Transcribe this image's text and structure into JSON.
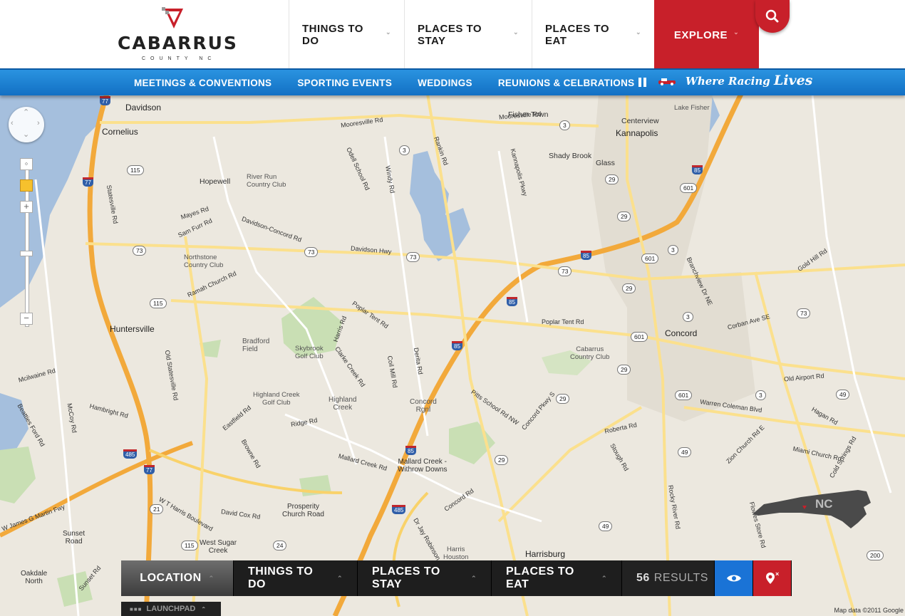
{
  "brand": {
    "name": "CABARRUS",
    "sub": "COUNTY NC"
  },
  "main_nav": [
    {
      "label": "THINGS TO DO"
    },
    {
      "label": "PLACES TO STAY"
    },
    {
      "label": "PLACES TO EAT"
    },
    {
      "label": "EXPLORE"
    }
  ],
  "sub_nav": [
    {
      "label": "MEETINGS & CONVENTIONS"
    },
    {
      "label": "SPORTING EVENTS"
    },
    {
      "label": "WEDDINGS"
    },
    {
      "label": "REUNIONS & CELBRATIONS"
    }
  ],
  "tagline": {
    "line1": "Where Racing",
    "line2": "Lives"
  },
  "map": {
    "cities": [
      {
        "name": "Davidson"
      },
      {
        "name": "Cornelius"
      },
      {
        "name": "Kannapolis"
      },
      {
        "name": "Concord"
      },
      {
        "name": "Huntersville"
      },
      {
        "name": "Harrisburg"
      },
      {
        "name": "Hopewell"
      },
      {
        "name": "Centerview"
      },
      {
        "name": "Fisher Town"
      },
      {
        "name": "Shady Brook"
      },
      {
        "name": "Glass"
      }
    ],
    "places": [
      {
        "name": "River Run\nCountry Club"
      },
      {
        "name": "Northstone\nCountry Club"
      },
      {
        "name": "Bradford\nField"
      },
      {
        "name": "Skybrook\nGolf Club"
      },
      {
        "name": "Highland Creek\nGolf Club"
      },
      {
        "name": "Highland\nCreek"
      },
      {
        "name": "Concord\nRgnl"
      },
      {
        "name": "Cabarrus\nCountry Club"
      },
      {
        "name": "Mallard Creek -\nWithrow Downs"
      },
      {
        "name": "Prosperity\nChurch Road"
      },
      {
        "name": "West Sugar\nCreek"
      },
      {
        "name": "Harris\nHouston"
      },
      {
        "name": "Sunset\nRoad"
      },
      {
        "name": "Oakdale\nNorth"
      },
      {
        "name": "Lake Fisher"
      }
    ],
    "roads": [
      "Mooresville Rd",
      "Davidson Hwy",
      "Davidson-Concord Rd",
      "Poplar Tent Rd",
      "Sam Furr Rd",
      "Mayes Rd",
      "Ramah Church Rd",
      "Statesville Rd",
      "Old Statesville Rd",
      "Hambright Rd",
      "Beatties Ford Rd",
      "Mallard Creek Rd",
      "Pitts School Rd NW",
      "Concord Pkwy S",
      "Roberta Rd",
      "Warren Coleman Blvd",
      "Old Airport Rd",
      "Miami Church Rd",
      "Zion Church Rd E",
      "Poplar Tent Rd",
      "David Cox Rd",
      "W T Harris Boulevard",
      "W James G Martin Fwy",
      "Concord Rd",
      "Odell School Rd",
      "Windy Rd",
      "Rankin Rd",
      "Kannapolis Pkwy",
      "Derita Rd",
      "Dr Jay Robinson",
      "Gold Hill Rd",
      "Corban Ave SE",
      "Branchview Dr NE",
      "Cold Springs Rd",
      "Hagan Rd",
      "Flowes Store Rd",
      "Rocky River Rd",
      "Stough Rd",
      "Mooresville Rd",
      "Ridge Rd",
      "Eastfield Rd",
      "Browne Rd",
      "Clarke Creek Rd",
      "Harris Rd",
      "Coil Mill Rd",
      "Sunset Rd",
      "McCoy Rd",
      "Mcilwaine Rd"
    ],
    "shields_state": [
      "3",
      "3",
      "73",
      "73",
      "73",
      "73",
      "115",
      "115",
      "115",
      "29",
      "29",
      "29",
      "29",
      "29",
      "29",
      "601",
      "601",
      "601",
      "601",
      "3",
      "3",
      "49",
      "49",
      "49",
      "200",
      "24",
      "21",
      "3",
      "73"
    ],
    "shields_interstate": [
      "77",
      "77",
      "85",
      "85",
      "85",
      "85",
      "85",
      "485",
      "485",
      "77"
    ],
    "copyright": "Map data ©2011 Google"
  },
  "bottom_bar": {
    "location": "LOCATION",
    "things": "THINGS TO DO",
    "stay": "PLACES TO STAY",
    "eat": "PLACES TO EAT",
    "results_count": "56",
    "results_label": "RESULTS"
  },
  "launchpad": "LAUNCHPAD",
  "nc_badge": "NC",
  "colors": {
    "brand_red": "#c8202a",
    "nav_blue": "#1f80d4",
    "bar_dark": "#1e1e1e"
  }
}
